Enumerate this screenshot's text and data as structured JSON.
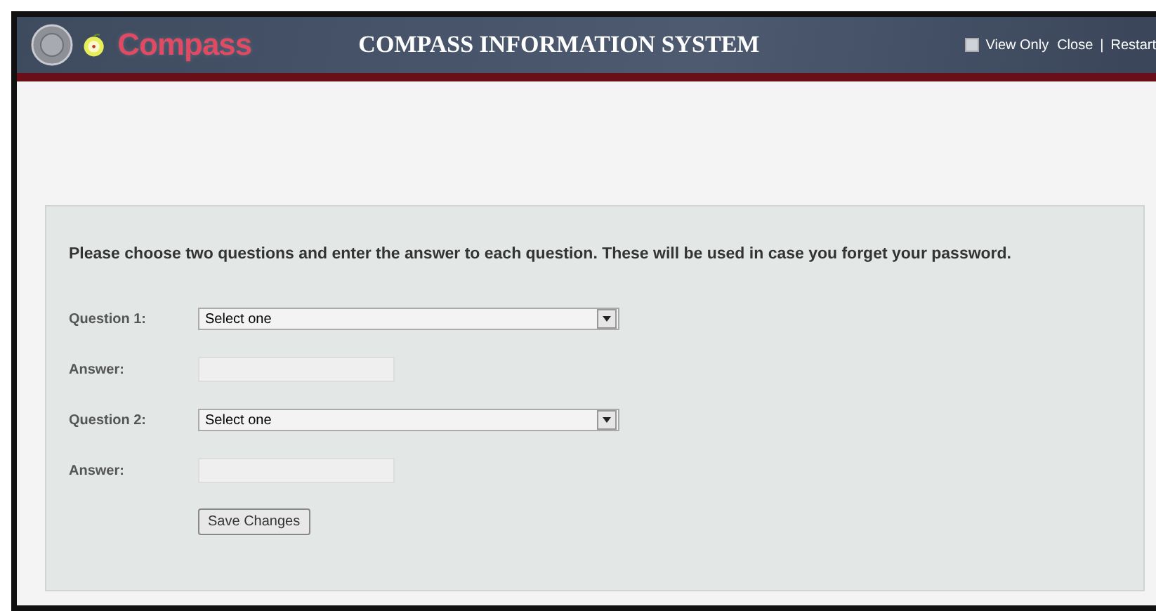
{
  "header": {
    "logo_text": "Compass",
    "title": "COMPASS INFORMATION SYSTEM",
    "view_only": {
      "label": "View Only",
      "checked": false
    },
    "links": [
      "Close",
      "Restart"
    ],
    "link_separator": "|"
  },
  "form": {
    "instructions": "Please choose two questions and enter the answer to each question. These will be used in case you forget your password.",
    "rows": [
      {
        "kind": "select",
        "label": "Question 1:",
        "value": "Select one"
      },
      {
        "kind": "text",
        "label": "Answer:"
      },
      {
        "kind": "select",
        "label": "Question 2:",
        "value": "Select one"
      },
      {
        "kind": "text",
        "label": "Answer:"
      }
    ],
    "button": "Save Changes"
  }
}
